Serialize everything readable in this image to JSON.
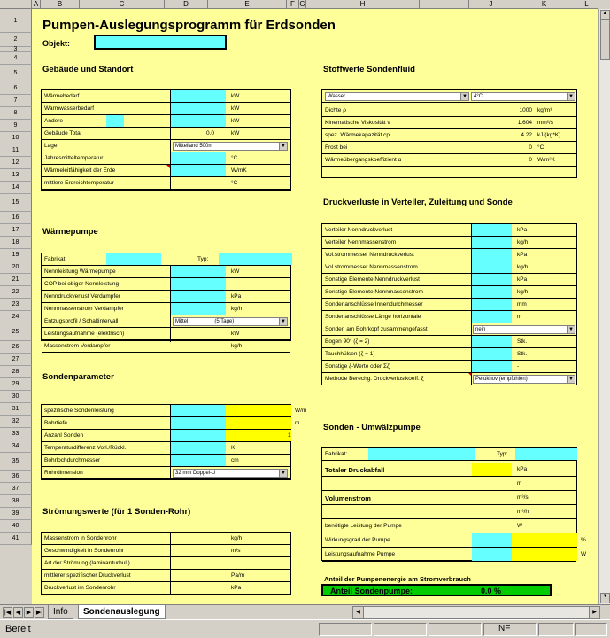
{
  "columns": [
    "A",
    "B",
    "C",
    "D",
    "E",
    "F",
    "G",
    "H",
    "I",
    "J",
    "K",
    "L"
  ],
  "title": "Pumpen-Auslegungsprogramm für Erdsonden",
  "objekt_label": "Objekt:",
  "sec_gebaeude": "Gebäude und Standort",
  "gebaeude": [
    {
      "label": "Wärmebedarf",
      "value": "",
      "unit": "kW"
    },
    {
      "label": "Warmwasserbedarf",
      "value": "",
      "unit": "kW"
    },
    {
      "label": "Andere",
      "value": "",
      "unit": "kW"
    },
    {
      "label": "Gebäude Total",
      "value": "0.0",
      "unit": "kW"
    },
    {
      "label": "Lage",
      "value": "",
      "unit": ""
    },
    {
      "label": "Jahresmitteltemperatur",
      "value": "",
      "unit": "°C"
    },
    {
      "label": "Wärmeleitfähigkeit der  Erde",
      "value": "",
      "unit": "W/mK"
    },
    {
      "label": "mittlere Erdreichtemperatur",
      "value": "",
      "unit": "°C"
    }
  ],
  "lage_select": "Mittelland 500m",
  "sec_waermepumpe": "Wärmepumpe",
  "fabrikat_label": "Fabrikat:",
  "typ_label": "Typ:",
  "waermepumpe": [
    {
      "label": "Nennleistung Wärmepumpe",
      "unit": "kW"
    },
    {
      "label": "COP bei obiger Nennleistung",
      "unit": "-"
    },
    {
      "label": "Nenndruckverlust Verdampfer",
      "unit": "kPa"
    },
    {
      "label": "Nennmassenstrom Verdampfer",
      "unit": "kg/h"
    },
    {
      "label": "Entzugsprofil / Schaltintervall",
      "unit": ""
    },
    {
      "label": "Leistungsaufnahme (elektrisch)",
      "unit": "kW"
    },
    {
      "label": "Massenstrom Verdampfer",
      "unit": "kg/h"
    }
  ],
  "entzug_select_a": "Mittel",
  "entzug_select_b": "(5 Tage)",
  "sec_sonden": "Sondenparameter",
  "sonden": [
    {
      "label": "spezifische Sondenleistung",
      "value": "",
      "unit": "W/m"
    },
    {
      "label": "Bohrtiefe",
      "value": "",
      "unit": "m"
    },
    {
      "label": "Anzahl Sonden",
      "value": "1",
      "unit": ""
    },
    {
      "label": "Temperaturdifferenz Vorl./Rückl.",
      "value": "",
      "unit": "K"
    },
    {
      "label": "Bohrlochdurchmesser",
      "value": "",
      "unit": "cm"
    },
    {
      "label": "Rohrdimension",
      "value": "",
      "unit": ""
    }
  ],
  "rohr_select": "32 mm Doppel-U",
  "sec_stroemung": "Strömungswerte (für 1 Sonden-Rohr)",
  "stroemung": [
    {
      "label": "Massenstrom in Sondenrohr",
      "unit": "kg/h"
    },
    {
      "label": "Geschwindigkeit in Sondenrohr",
      "unit": "m/s"
    },
    {
      "label": "Art der Strömung (laminar/turbul.)",
      "unit": ""
    },
    {
      "label": "mittlerer spezifischer Druckverlust",
      "unit": "Pa/m"
    },
    {
      "label": "Druckverlust im Sondenrohr",
      "unit": "kPa"
    }
  ],
  "sec_stoffwerte": "Stoffwerte Sondenfluid",
  "fluid_select": "Wasser",
  "temp_select": "4°C",
  "stoffwerte": [
    {
      "label": "Dichte  ρ",
      "value": "1000",
      "unit": "kg/m³"
    },
    {
      "label": "Kinematische Viskosität ν",
      "value": "1.604",
      "unit": "mm²/s"
    },
    {
      "label": "spez. Wärmekapazität cp",
      "value": "4.22",
      "unit": "kJ/(kg*K)"
    },
    {
      "label": "Frost bei",
      "value": "0",
      "unit": "°C"
    },
    {
      "label": "Wärmeübergangskoeffizient α",
      "value": "0",
      "unit": "W/m²K"
    }
  ],
  "sec_druck": "Druckverluste in Verteiler, Zuleitung und Sonde",
  "druck": [
    {
      "label": "Verteiler Nenndruckverlust",
      "unit": "kPa"
    },
    {
      "label": "Verteiler Nennmassenstrom",
      "unit": "kg/h"
    },
    {
      "label": "Vol.strommesser Nenndruckverlust",
      "unit": "kPa"
    },
    {
      "label": "Vol.strommesser Nennmassenstrom",
      "unit": "kg/h"
    },
    {
      "label": "Sonstige Elemente Nenndruckverlust",
      "unit": "kPa"
    },
    {
      "label": "Sonstige Elemente Nennmassenstrom",
      "unit": "kg/h"
    },
    {
      "label": "Sondenanschlüsse Innendurchmesser",
      "unit": "mm"
    },
    {
      "label": "Sondenanschlüsse Länge horizontale",
      "unit": "m"
    },
    {
      "label": "Sonden am Bohrkopf zusammengefasst",
      "unit": ""
    },
    {
      "label": "Bogen 90° (ζ = 2)",
      "unit": "Stk."
    },
    {
      "label": "Tauchhülsen (ζ = 1)",
      "unit": "Stk."
    },
    {
      "label": "Sonstige ζ-Werte oder Σζ",
      "unit": "-"
    },
    {
      "label": "Methode Berechg. Druckverlustkoeff. ξ",
      "unit": ""
    }
  ],
  "bohrkopf_select": "nein",
  "methode_select": "Petukhov (empfohlen)",
  "sec_pumpe": "Sonden - Umwälzpumpe",
  "pumpe": [
    {
      "label": "Totaler Druckabfall",
      "unit": "kPa",
      "bold": true
    },
    {
      "label": "",
      "unit": "m"
    },
    {
      "label": "Volumenstrom",
      "unit": "m³/s",
      "bold": true
    },
    {
      "label": "",
      "unit": "m³/h"
    },
    {
      "label": "benötigte Leistung der Pumpe",
      "unit": "W"
    },
    {
      "label": "Wirkungsgrad der Pumpe",
      "unit": "%"
    },
    {
      "label": "Leistungsaufnahme Pumpe",
      "unit": "W"
    }
  ],
  "anteil_title": "Anteil  der Pumpenenergie am Stromverbrauch",
  "anteil_label": "Anteil Sondenpumpe:",
  "anteil_value": "0.0 %",
  "tabs": [
    "Info",
    "Sondenauslegung"
  ],
  "status_text": "Bereit",
  "status_nf": "NF"
}
